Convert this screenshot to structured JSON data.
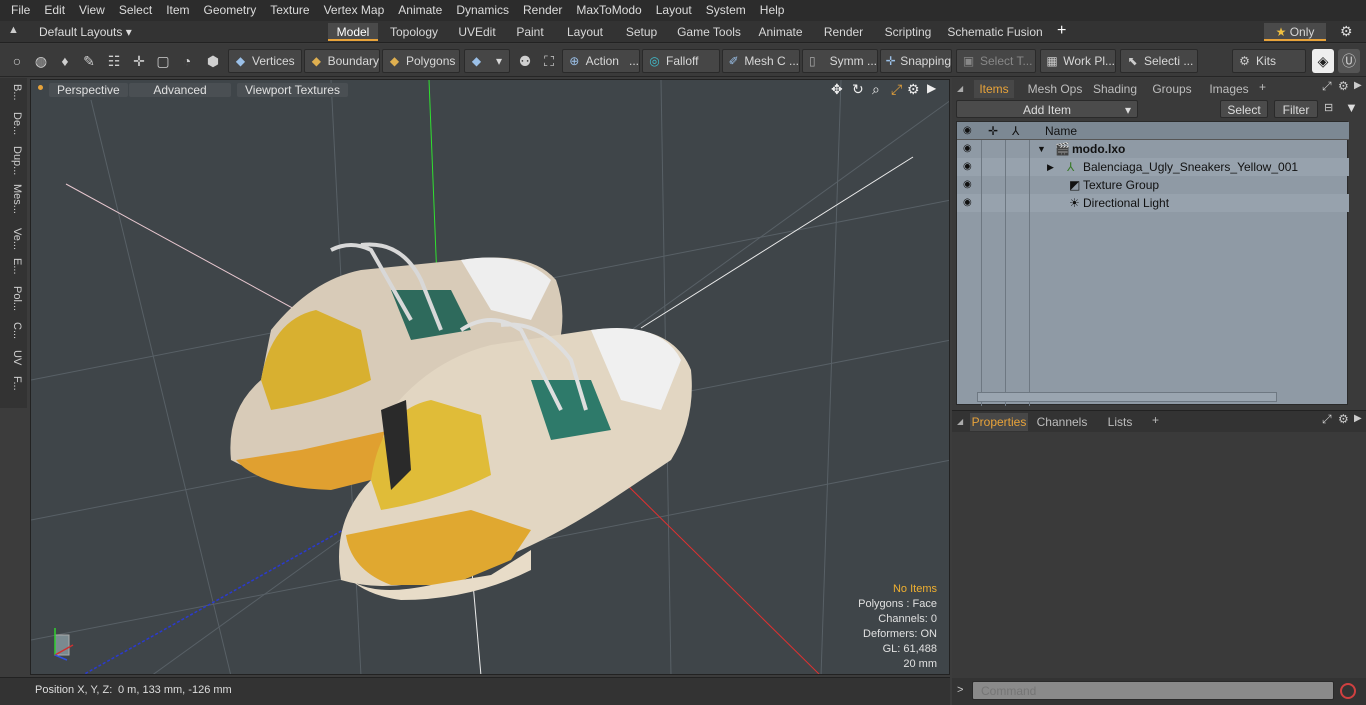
{
  "menu": [
    "File",
    "Edit",
    "View",
    "Select",
    "Item",
    "Geometry",
    "Texture",
    "Vertex Map",
    "Animate",
    "Dynamics",
    "Render",
    "MaxToModo",
    "Layout",
    "System",
    "Help"
  ],
  "layout": {
    "default_layouts": "Default Layouts",
    "tabs": [
      "Model",
      "Topology",
      "UVEdit",
      "Paint",
      "Layout",
      "Setup",
      "Game Tools",
      "Animate",
      "Render",
      "Scripting",
      "Schematic Fusion"
    ],
    "active_tab": "Model",
    "add_tab": "+",
    "only_label": "Only"
  },
  "toolbar": {
    "vertices": "Vertices",
    "boundary": "Boundary",
    "polygons": "Polygons",
    "action": "Action",
    "falloff": "Falloff",
    "mesh": "Mesh C ...",
    "symm": "Symm ...",
    "snapping": "Snapping",
    "select_t": "Select T...",
    "work_pl": "Work Pl...",
    "selecti": "Selecti ...",
    "kits": "Kits"
  },
  "left_tabs": [
    "B...",
    "De...",
    "Dup...",
    "Mes...",
    "Ve...",
    "E...",
    "Pol...",
    "C...",
    "UV",
    "F..."
  ],
  "viewport": {
    "perspective": "Perspective",
    "advanced": "Advanced",
    "viewport_textures": "Viewport Textures",
    "info": {
      "no_items": "No Items",
      "polygons": "Polygons : Face",
      "channels": "Channels: 0",
      "deformers": "Deformers: ON",
      "gl": "GL: 61,488",
      "scale": "20 mm"
    }
  },
  "status": {
    "position_label": "Position X, Y, Z:",
    "position_value": "0 m, 133 mm, -126 mm"
  },
  "items_panel": {
    "tabs": [
      "Items",
      "Mesh Ops",
      "Shading",
      "Groups",
      "Images"
    ],
    "active_tab": "Items",
    "add_item": "Add Item",
    "select": "Select",
    "filter": "Filter",
    "column_name": "Name",
    "rows": [
      {
        "name": "modo.lxo"
      },
      {
        "name": "Balenciaga_Ugly_Sneakers_Yellow_001"
      },
      {
        "name": "Texture Group"
      },
      {
        "name": "Directional Light"
      }
    ]
  },
  "props_panel": {
    "tabs": [
      "Properties",
      "Channels",
      "Lists"
    ],
    "active_tab": "Properties"
  },
  "command": {
    "placeholder": "Command"
  }
}
